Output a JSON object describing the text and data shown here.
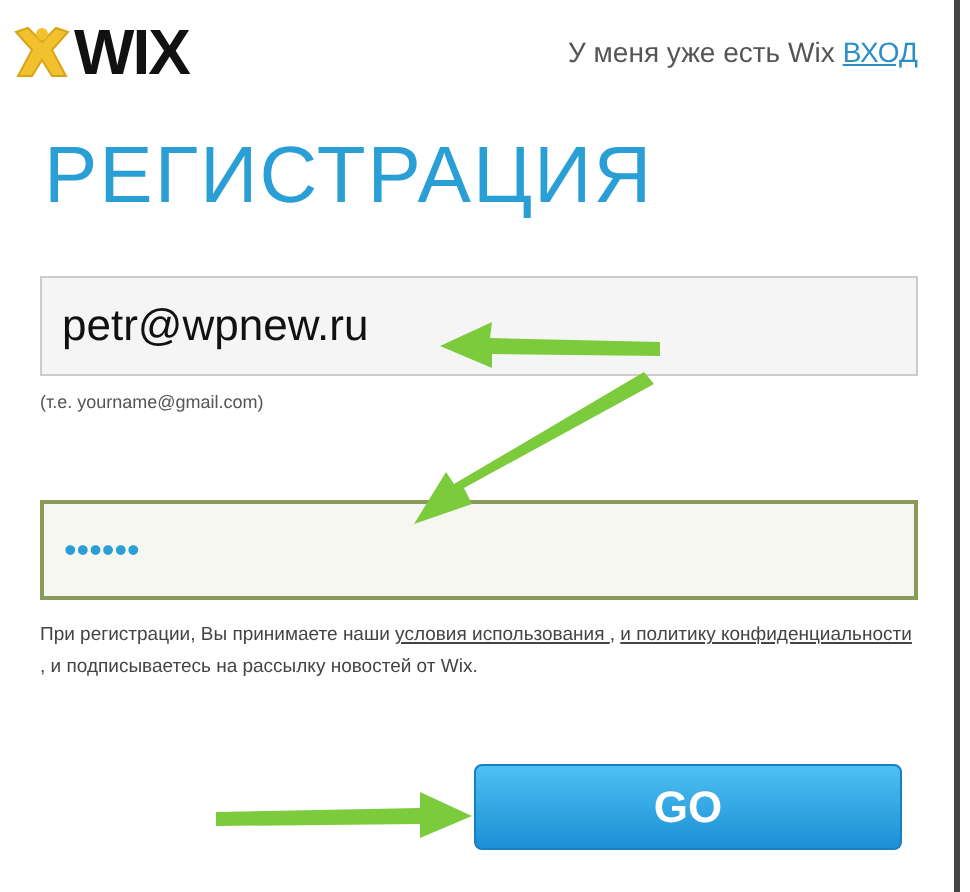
{
  "logo": {
    "text": "WIX"
  },
  "login_prompt": {
    "text": "У меня уже есть Wix",
    "link": "ВХОД"
  },
  "heading": "РЕГИСТРАЦИЯ",
  "email": {
    "value": "petr@wpnew.ru",
    "hint": "(т.е. yourname@gmail.com)",
    "focused": false
  },
  "password": {
    "value": "••••••",
    "focused": true
  },
  "terms": [
    {
      "kind": "text",
      "text": "При регистрации, Вы принимаете наши "
    },
    {
      "kind": "link",
      "text": "условия использования "
    },
    {
      "kind": "text",
      "text": ", "
    },
    {
      "kind": "link",
      "text": "и политику конфиденциальности"
    },
    {
      "kind": "text",
      "text": " , и подписываетесь на рассылку новостей от Wix."
    }
  ],
  "submit": "GO"
}
